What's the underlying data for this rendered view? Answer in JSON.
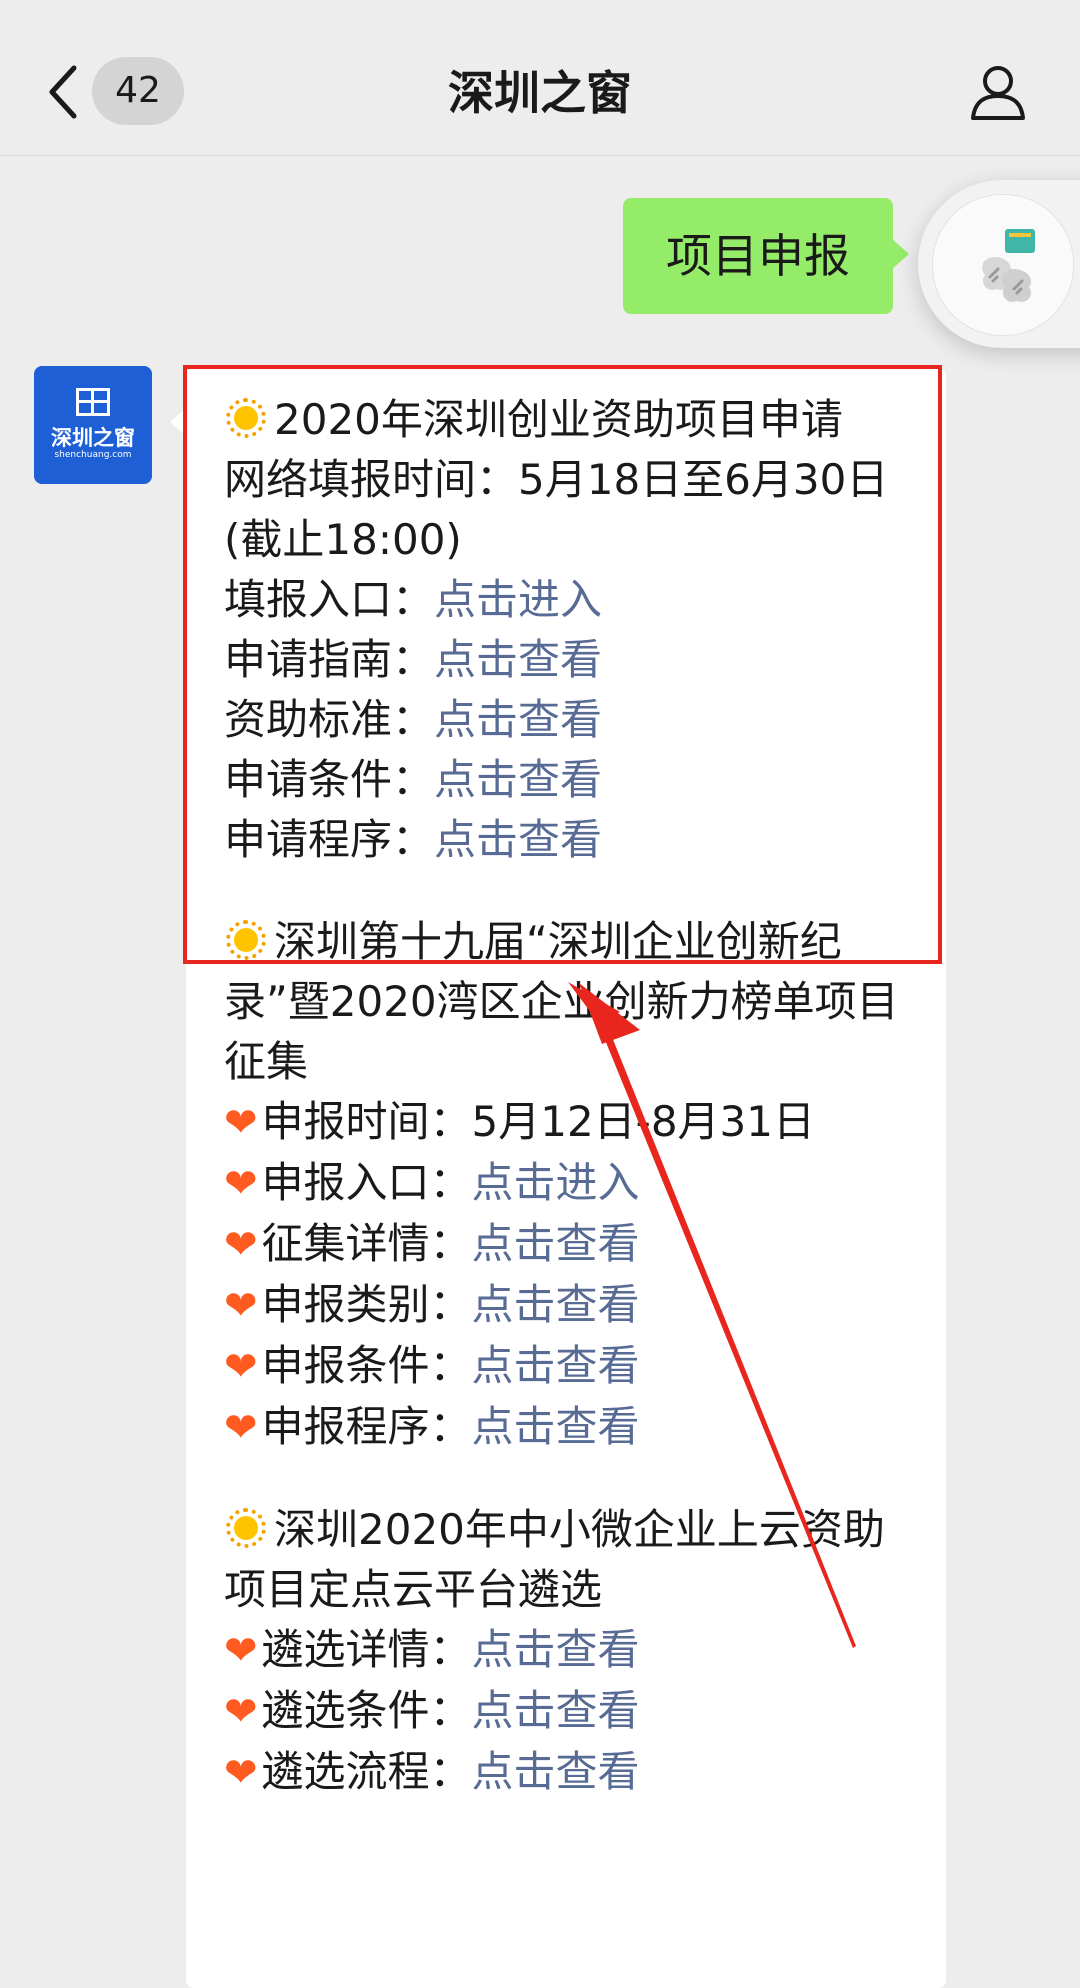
{
  "header": {
    "title": "深圳之窗",
    "unread_count": "42",
    "back_icon": "chevron-left-icon",
    "profile_icon": "person-icon"
  },
  "outgoing": {
    "message": "项目申报"
  },
  "account": {
    "logo_text": "深圳之窗",
    "logo_url": "shenchuang.com",
    "brand_color": "#1e5fd6"
  },
  "sections": [
    {
      "title": "2020年深圳创业资助项目申请",
      "lines": [
        "网络填报时间：5月18日至6月30日 (截止18:00)"
      ],
      "items": [
        {
          "label": "填报入口：",
          "link": "点击进入"
        },
        {
          "label": "申请指南：",
          "link": "点击查看"
        },
        {
          "label": "资助标准：",
          "link": "点击查看"
        },
        {
          "label": "申请条件：",
          "link": "点击查看"
        },
        {
          "label": "申请程序：",
          "link": "点击查看"
        }
      ]
    },
    {
      "title": "深圳第十九届“深圳企业创新纪录”暨2020湾区企业创新力榜单项目征集",
      "time_line": "申报时间：5月12日-8月31日",
      "items": [
        {
          "label": "申报入口：",
          "link": "点击进入"
        },
        {
          "label": "征集详情：",
          "link": "点击查看"
        },
        {
          "label": "申报类别：",
          "link": "点击查看"
        },
        {
          "label": "申报条件：",
          "link": "点击查看"
        },
        {
          "label": "申报程序：",
          "link": "点击查看"
        }
      ]
    },
    {
      "title": "深圳2020年中小微企业上云资助项目定点云平台遴选",
      "items": [
        {
          "label": "遴选详情：",
          "link": "点击查看"
        },
        {
          "label": "遴选条件：",
          "link": "点击查看"
        },
        {
          "label": "遴选流程：",
          "link": "点击查看"
        }
      ]
    }
  ],
  "colors": {
    "background": "#ededed",
    "outgoing_bubble": "#95ec69",
    "link": "#576b95",
    "highlight": "#e8261e"
  }
}
